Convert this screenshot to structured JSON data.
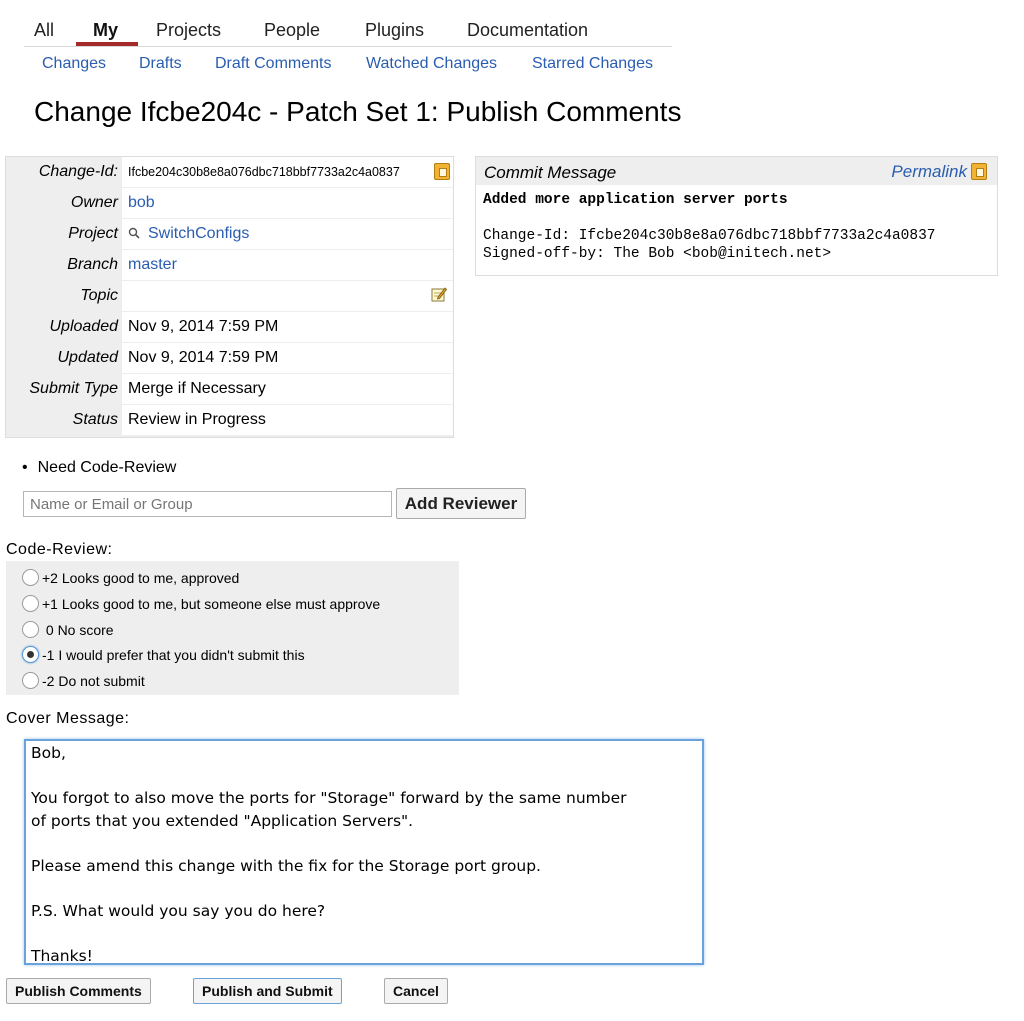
{
  "nav": {
    "tabs": [
      "All",
      "My",
      "Projects",
      "People",
      "Plugins",
      "Documentation"
    ],
    "active_tab": "My",
    "subtabs": [
      "Changes",
      "Drafts",
      "Draft Comments",
      "Watched Changes",
      "Starred Changes"
    ]
  },
  "title": "Change Ifcbe204c - Patch Set 1: Publish Comments",
  "info": {
    "change_id_label": "Change-Id:",
    "change_id": "Ifcbe204c30b8e8a076dbc718bbf7733a2c4a0837",
    "owner_label": "Owner",
    "owner": "bob",
    "project_label": "Project",
    "project": "SwitchConfigs",
    "branch_label": "Branch",
    "branch": "master",
    "topic_label": "Topic",
    "topic": "",
    "uploaded_label": "Uploaded",
    "uploaded": "Nov 9, 2014 7:59 PM",
    "updated_label": "Updated",
    "updated": "Nov 9, 2014 7:59 PM",
    "submit_type_label": "Submit Type",
    "submit_type": "Merge if Necessary",
    "status_label": "Status",
    "status": "Review in Progress"
  },
  "commit": {
    "heading": "Commit Message",
    "permalink": "Permalink",
    "subject": "Added more application server ports",
    "body": "Change-Id: Ifcbe204c30b8e8a076dbc718bbf7733a2c4a0837\nSigned-off-by: The Bob <bob@initech.net>"
  },
  "need": "Need Code-Review",
  "reviewer": {
    "placeholder": "Name or Email or Group",
    "button": "Add Reviewer"
  },
  "code_review": {
    "label": "Code-Review:",
    "options": [
      "+2 Looks good to me, approved",
      "+1 Looks good to me, but someone else must approve",
      " 0 No score",
      "-1 I would prefer that you didn't submit this",
      "-2 Do not submit"
    ],
    "selected": "-1"
  },
  "cover": {
    "label": "Cover Message:",
    "text": "Bob,\n\nYou forgot to also move the ports for \"Storage\" forward by the same number\nof ports that you extended \"Application Servers\".\n\nPlease amend this change with the fix for the Storage port group.\n\nP.S. What would you say you do here?\n\nThanks!"
  },
  "buttons": {
    "publish": "Publish Comments",
    "publish_submit": "Publish and Submit",
    "cancel": "Cancel"
  },
  "colors": {
    "link": "#2a5db0",
    "active_tab_underline": "#a52a2a",
    "panel_bg": "#eeeeee"
  }
}
